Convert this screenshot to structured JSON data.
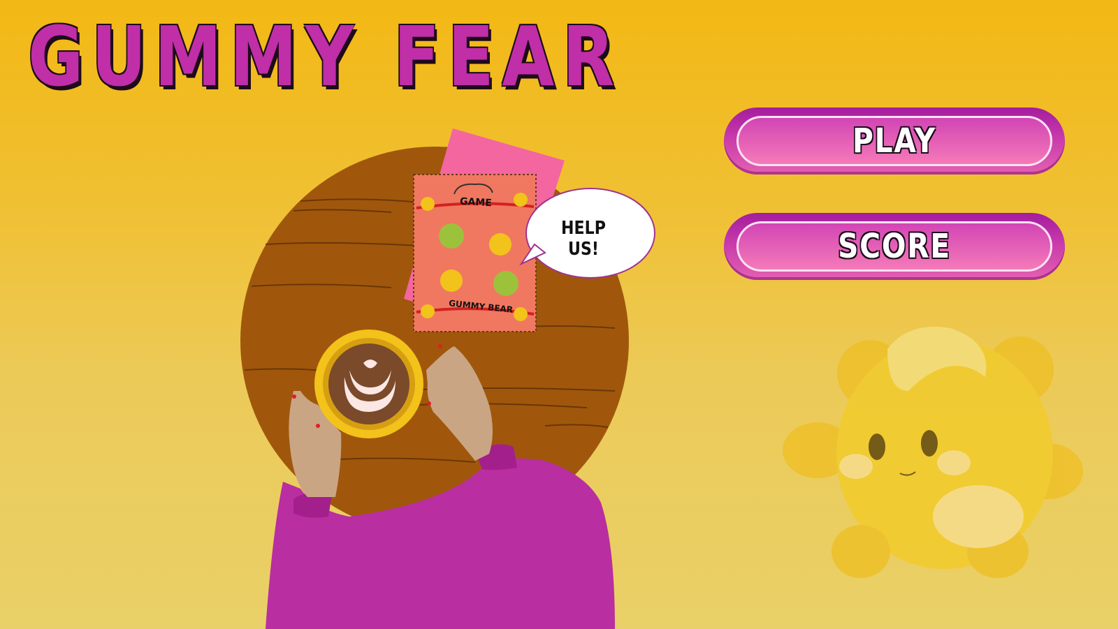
{
  "game": {
    "title": "GUMMY FEAR",
    "menu": {
      "play_label": "PLAY",
      "score_label": "SCORE"
    },
    "speech_bubble": "HELP US!",
    "candy_pack": {
      "top_label": "GAME",
      "bottom_label": "GUMMY BEAR"
    }
  },
  "colors": {
    "background_top": "#f2b814",
    "background_bottom": "#e9d068",
    "title": "#c02ea8",
    "button": "#c83aac",
    "table": "#a0570c",
    "sweater": "#b92ea0",
    "mascot": "#f1cb2f"
  },
  "icons": [
    "star-icon",
    "heart-latte-art",
    "gummy-bear-mascot"
  ]
}
